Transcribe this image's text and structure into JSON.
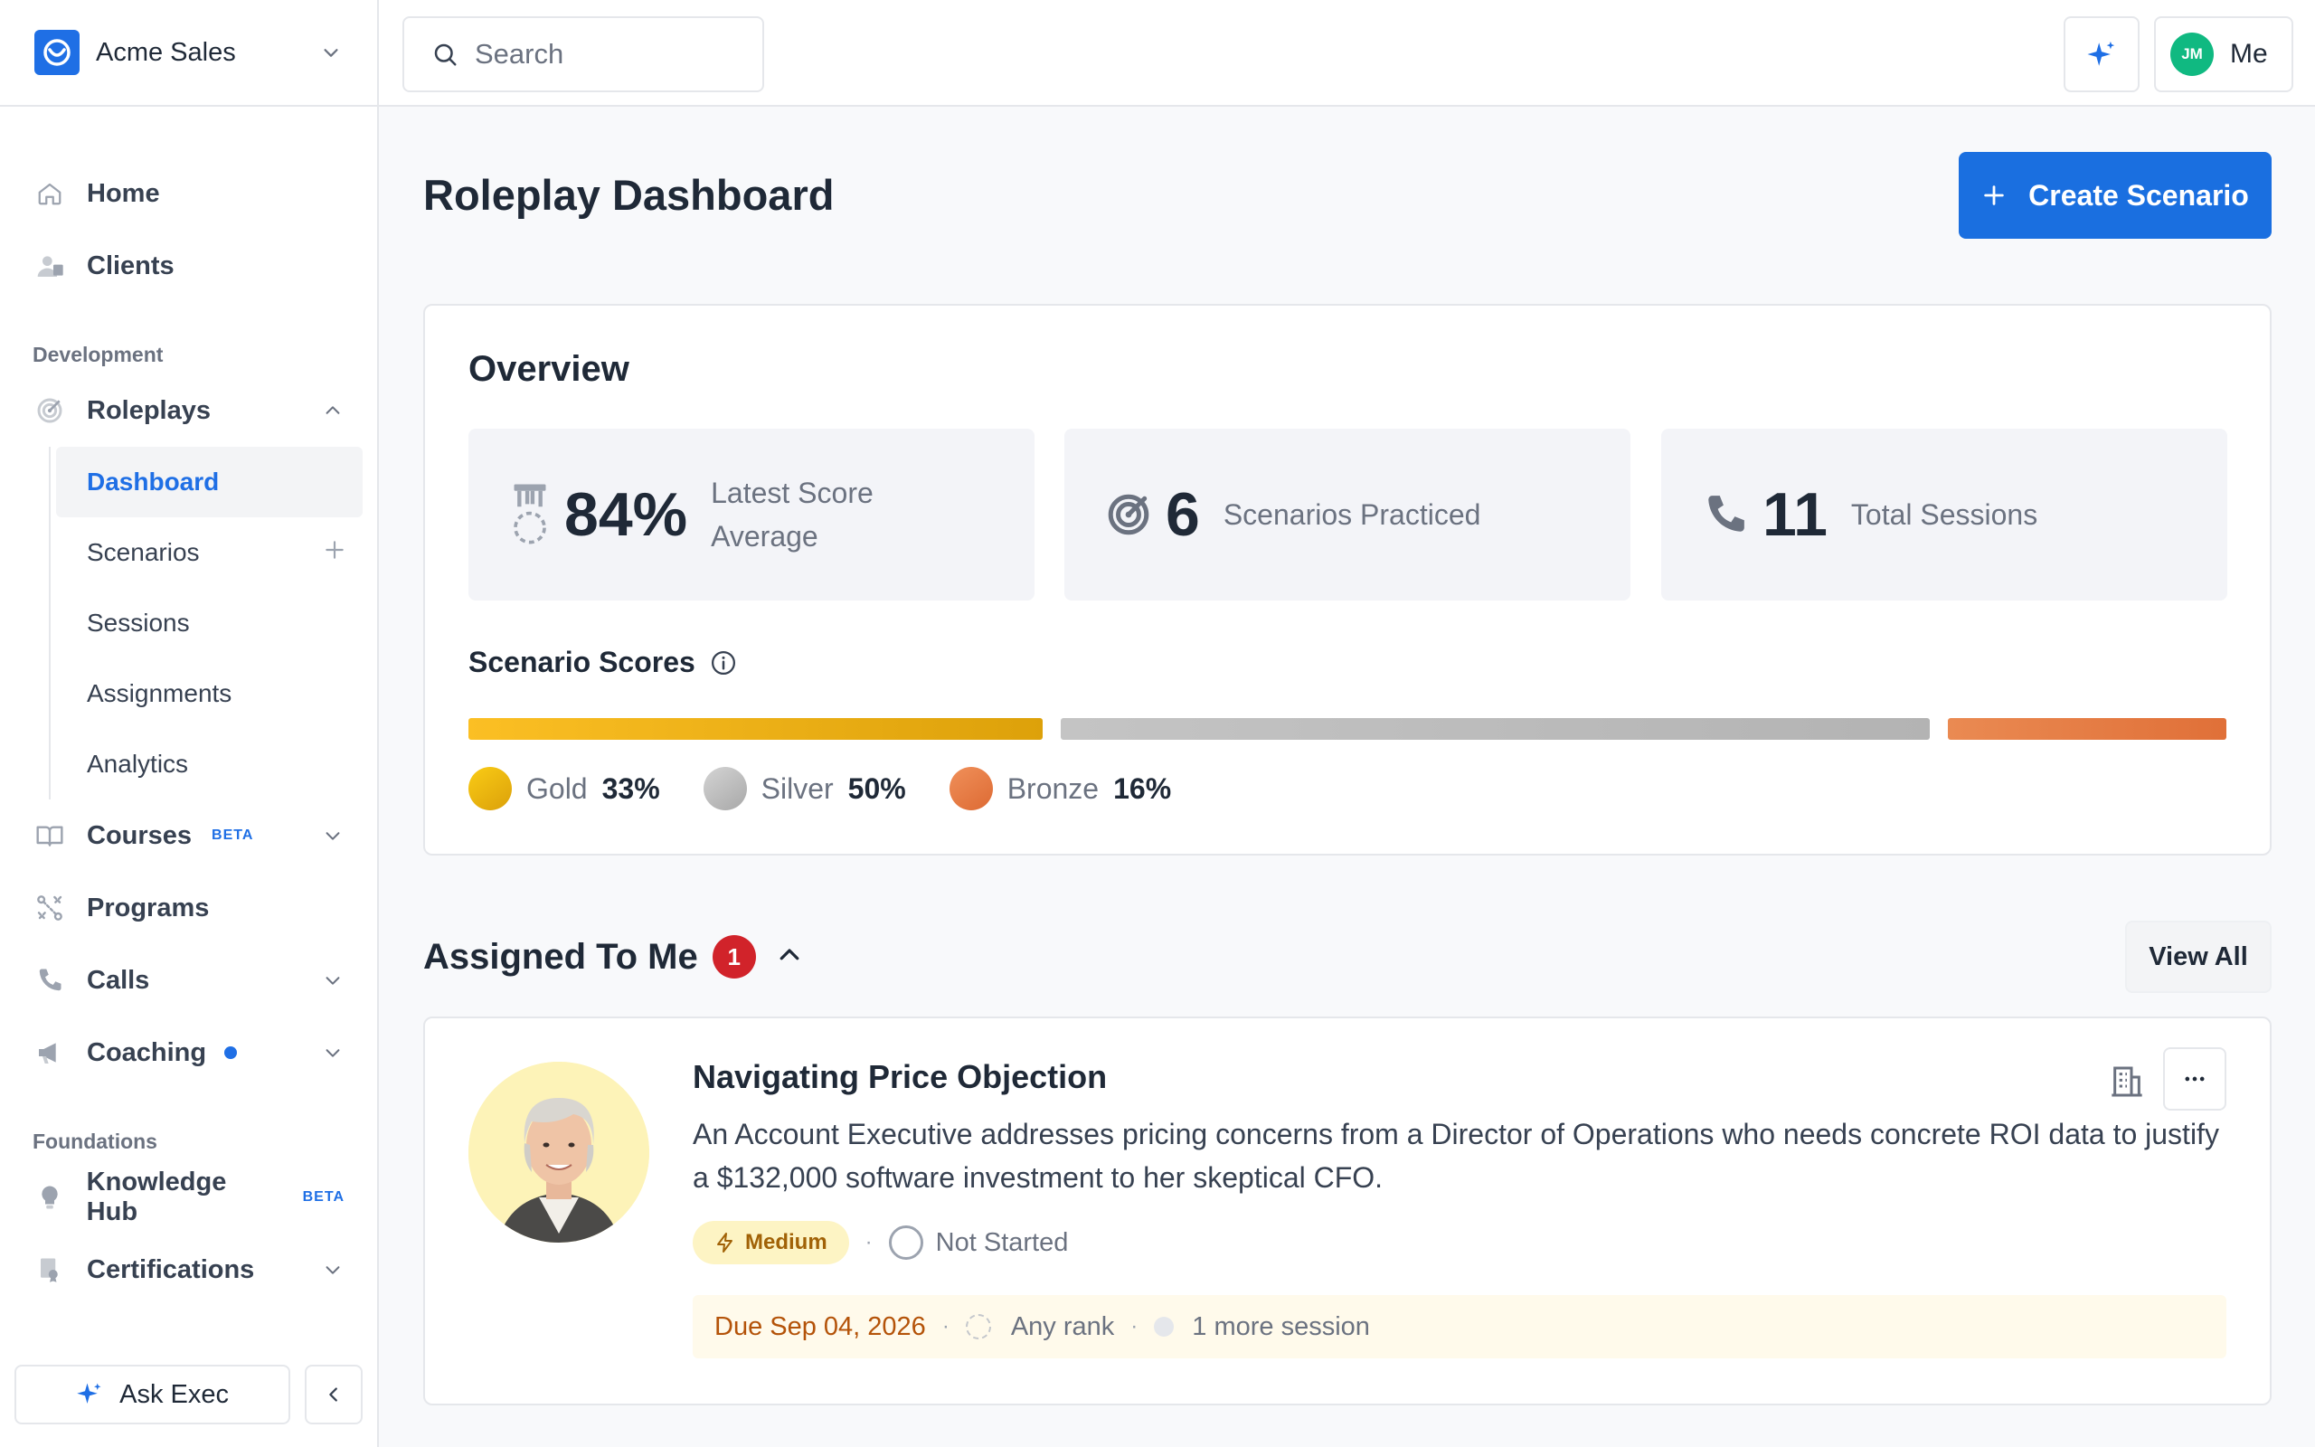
{
  "workspace": {
    "name": "Acme Sales"
  },
  "search": {
    "placeholder": "Search"
  },
  "topbar": {
    "me_label": "Me",
    "initials": "JM"
  },
  "sidebar": {
    "home": "Home",
    "clients": "Clients",
    "section_development": "Development",
    "roleplays": "Roleplays",
    "roleplay_items": [
      "Dashboard",
      "Scenarios",
      "Sessions",
      "Assignments",
      "Analytics"
    ],
    "courses": "Courses",
    "courses_badge": "BETA",
    "programs": "Programs",
    "calls": "Calls",
    "coaching": "Coaching",
    "section_foundations": "Foundations",
    "knowledge_hub": "Knowledge Hub",
    "knowledge_badge": "BETA",
    "certifications": "Certifications",
    "ask_exec": "Ask Exec"
  },
  "page": {
    "title": "Roleplay Dashboard",
    "create_label": "Create Scenario"
  },
  "overview": {
    "title": "Overview",
    "stats": [
      {
        "value": "84%",
        "label_line1": "Latest Score",
        "label_line2": "Average",
        "icon": "medal-icon"
      },
      {
        "value": "6",
        "label": "Scenarios Practiced",
        "icon": "target-icon"
      },
      {
        "value": "11",
        "label": "Total Sessions",
        "icon": "phone-icon"
      }
    ],
    "scores_title": "Scenario Scores",
    "scores": [
      {
        "name": "Gold",
        "value": "33%",
        "fraction": 0.33,
        "color": "#eab308"
      },
      {
        "name": "Silver",
        "value": "50%",
        "fraction": 0.5,
        "color": "#b8b8b8"
      },
      {
        "name": "Bronze",
        "value": "16%",
        "fraction": 0.16,
        "color": "#e4783f"
      }
    ]
  },
  "assigned": {
    "title": "Assigned To Me",
    "count": "1",
    "view_all": "View All",
    "item": {
      "title": "Navigating Price Objection",
      "description": "An Account Executive addresses pricing concerns from a Director of Operations who needs concrete ROI data to justify a $132,000 software investment to her skeptical CFO.",
      "difficulty": "Medium",
      "status": "Not Started",
      "due": "Due Sep 04, 2026",
      "rank": "Any rank",
      "sessions": "1 more session"
    }
  }
}
